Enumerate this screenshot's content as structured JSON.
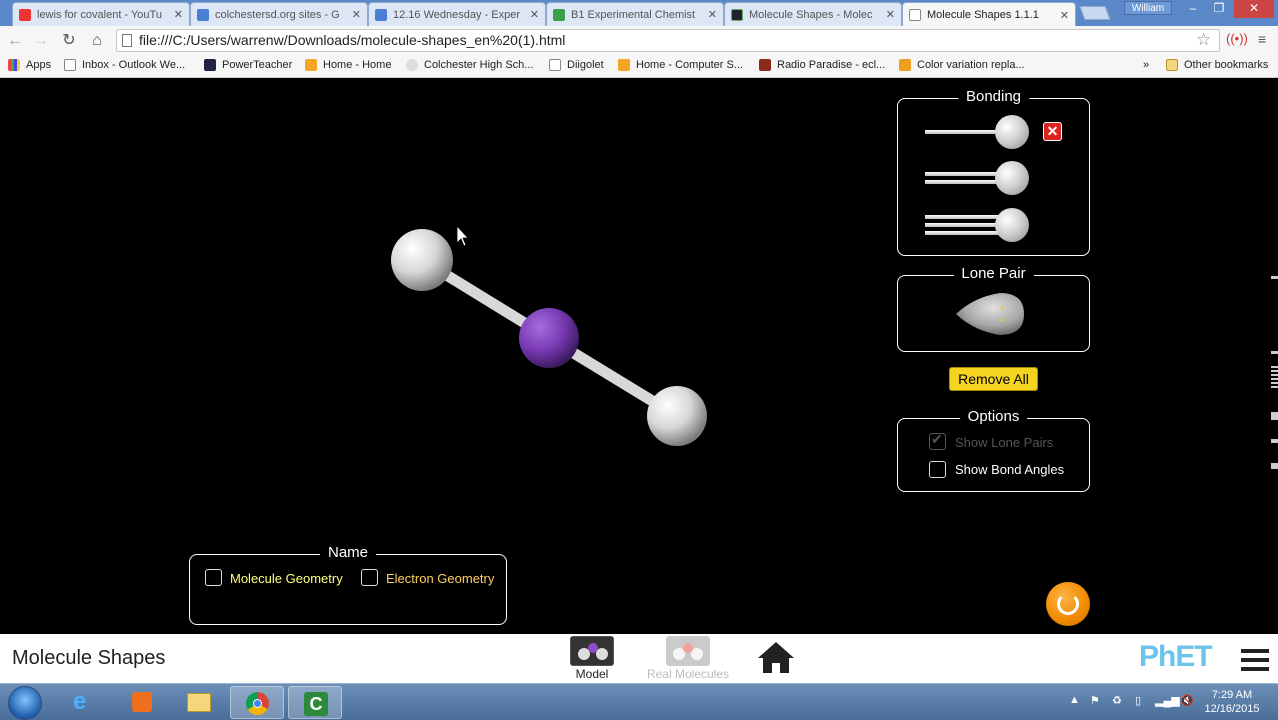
{
  "browser": {
    "tabs": [
      {
        "label": "lewis for covalent - YouTu",
        "icon": "youtube-icon",
        "color": "#e33"
      },
      {
        "label": "colchestersd.org sites - G",
        "icon": "docs-icon",
        "color": "#4a7fd4"
      },
      {
        "label": "12.16 Wednesday - Exper",
        "icon": "docs-icon",
        "color": "#4a7fd4"
      },
      {
        "label": "B1 Experimental Chemist",
        "icon": "drive-icon",
        "color": "#3a9f4a"
      },
      {
        "label": "Molecule Shapes - Molec",
        "icon": "phet-icon",
        "color": "#223"
      },
      {
        "label": "Molecule Shapes 1.1.1",
        "icon": "page-icon",
        "color": "#fff"
      }
    ],
    "user_label": "William",
    "url": "file:///C:/Users/warrenw/Downloads/molecule-shapes_en%20(1).html",
    "bookmarks": [
      {
        "label": "Apps",
        "icon": "apps-icon"
      },
      {
        "label": "Inbox - Outlook We...",
        "icon": "page-icon"
      },
      {
        "label": "PowerTeacher",
        "icon": "powerteacher-icon"
      },
      {
        "label": "Home - Home",
        "icon": "home-site-icon"
      },
      {
        "label": "Colchester High Sch...",
        "icon": "cloud-icon"
      },
      {
        "label": "Diigolet",
        "icon": "page-icon"
      },
      {
        "label": "Home - Computer S...",
        "icon": "home-site-icon"
      },
      {
        "label": "Radio Paradise - ecl...",
        "icon": "rp-icon"
      },
      {
        "label": "Color variation repla...",
        "icon": "app-icon"
      }
    ],
    "other_bookmarks": "Other bookmarks",
    "overflow": "»"
  },
  "sim": {
    "bonding_title": "Bonding",
    "lone_pair_title": "Lone Pair",
    "remove_all_label": "Remove All",
    "options_title": "Options",
    "show_lone_pairs_label": "Show Lone Pairs",
    "show_lone_pairs_checked": true,
    "show_bond_angles_label": "Show Bond Angles",
    "show_bond_angles_checked": false,
    "name_title": "Name",
    "molecule_geometry_label": "Molecule Geometry",
    "electron_geometry_label": "Electron Geometry",
    "central_atom_color": "#7a3bb5",
    "outer_atom_color": "#e8e8e8"
  },
  "navbar": {
    "sim_title": "Molecule Shapes",
    "screens": [
      {
        "label": "Model",
        "selected": true
      },
      {
        "label": "Real Molecules",
        "selected": false
      }
    ],
    "brand": "PhET"
  },
  "taskbar": {
    "time": "7:29 AM",
    "date": "12/16/2015"
  }
}
